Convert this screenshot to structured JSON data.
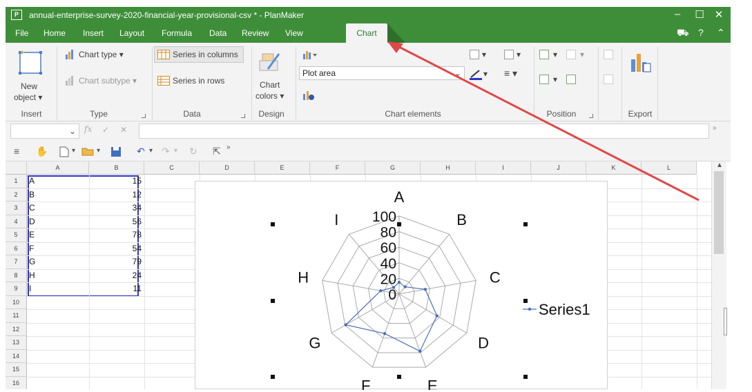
{
  "window": {
    "title": "annual-enterprise-survey-2020-financial-year-provisional-csv * - PlanMaker",
    "app_icon": "P"
  },
  "menu": {
    "items": [
      "File",
      "Home",
      "Insert",
      "Layout",
      "Formula",
      "Data",
      "Review",
      "View"
    ],
    "active_tab": "Chart"
  },
  "ribbon": {
    "insert": {
      "new_object_line1": "New",
      "new_object_line2": "object ▾",
      "label": "Insert"
    },
    "type": {
      "chart_type": "Chart type ▾",
      "chart_subtype": "Chart subtype ▾",
      "label": "Type"
    },
    "data": {
      "series_columns": "Series in columns",
      "series_rows": "Series in rows",
      "label": "Data"
    },
    "design": {
      "chart_colors_line1": "Chart",
      "chart_colors_line2": "colors ▾",
      "label": "Design"
    },
    "elements": {
      "selected_element": "Plot area",
      "label": "Chart elements"
    },
    "position": {
      "label": "Position"
    },
    "export": {
      "label": "Export"
    }
  },
  "formula": {
    "fx": "fx",
    "check": "✓",
    "cancel": "✕"
  },
  "sheet": {
    "columns": [
      "A",
      "B",
      "C",
      "D",
      "E",
      "F",
      "G",
      "H",
      "I",
      "J",
      "K",
      "L"
    ],
    "rows": [
      "1",
      "2",
      "3",
      "4",
      "5",
      "6",
      "7",
      "8",
      "9",
      "10",
      "11",
      "12",
      "13",
      "14",
      "15",
      "16"
    ],
    "cells": [
      {
        "label": "A",
        "value": "15"
      },
      {
        "label": "B",
        "value": "12"
      },
      {
        "label": "C",
        "value": "34"
      },
      {
        "label": "D",
        "value": "56"
      },
      {
        "label": "E",
        "value": "78"
      },
      {
        "label": "F",
        "value": "54"
      },
      {
        "label": "G",
        "value": "79"
      },
      {
        "label": "H",
        "value": "24"
      },
      {
        "label": "I",
        "value": "11"
      }
    ]
  },
  "chart_data": {
    "type": "radar",
    "categories": [
      "A",
      "B",
      "C",
      "D",
      "E",
      "F",
      "G",
      "H",
      "I"
    ],
    "series": [
      {
        "name": "Series1",
        "values": [
          15,
          12,
          34,
          56,
          78,
          54,
          79,
          24,
          11
        ]
      }
    ],
    "ylim": [
      0,
      100
    ],
    "ticks": [
      "0",
      "20",
      "40",
      "60",
      "80",
      "100"
    ],
    "series_color": "#4a6fb5"
  },
  "colors": {
    "ribbon_green": "#3e8e39",
    "selection_blue": "#2b35c9",
    "annotation_red": "#e04848"
  }
}
